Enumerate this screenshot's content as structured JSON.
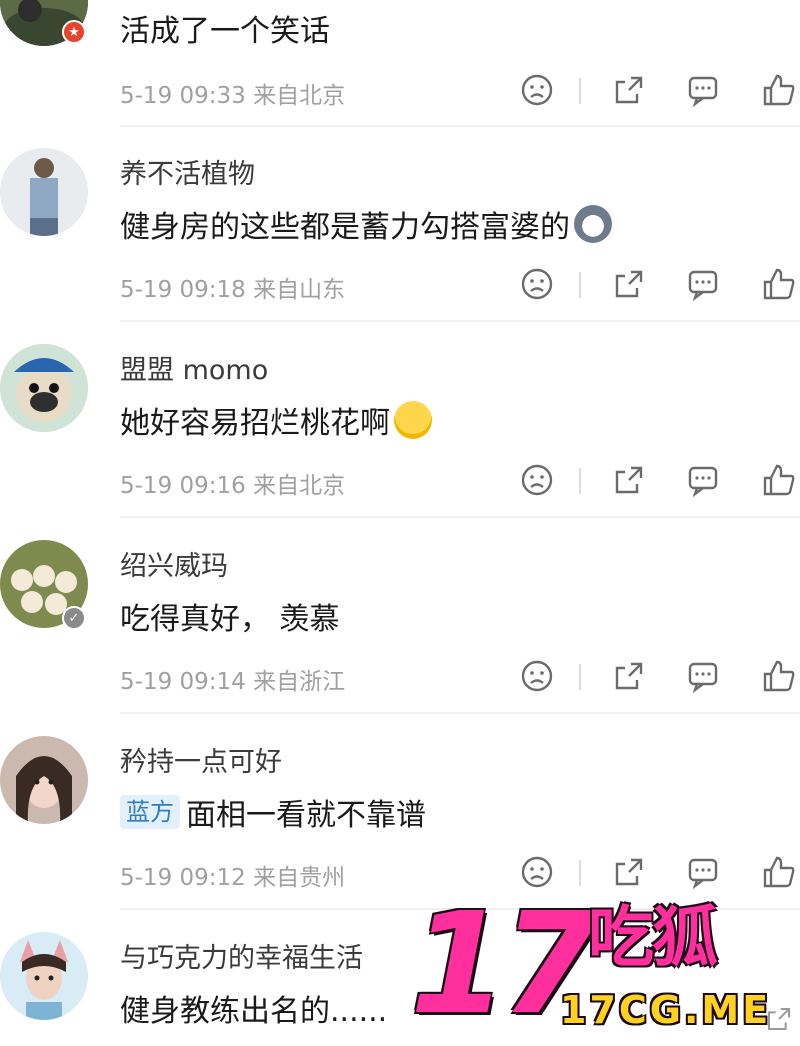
{
  "comments": [
    {
      "username": "",
      "content": "活成了一个笑话",
      "meta": "5-19 09:33 来自北京",
      "badge": "red-star-badge"
    },
    {
      "username": "养不活植物",
      "content": "健身房的这些都是蓄力勾搭富婆的",
      "emoji": "dog-face-emoji",
      "meta": "5-19 09:18 来自山东"
    },
    {
      "username": "盟盟 momo",
      "content": "她好容易招烂桃花啊",
      "emoji": "laugh-cry-emoji",
      "meta": "5-19 09:16 来自北京"
    },
    {
      "username": "绍兴威玛",
      "content": "吃得真好， 羡慕",
      "meta": "5-19 09:14 来自浙江",
      "badge": "verified-badge"
    },
    {
      "username": "矜持一点可好",
      "tag": "蓝方",
      "content": "面相一看就不靠谱",
      "meta": "5-19 09:12 来自贵州"
    },
    {
      "username": "与巧克力的幸福生活",
      "content": "健身教练出名的......",
      "meta": ""
    }
  ],
  "watermark": {
    "number": "17",
    "chinese": "吃狐",
    "site": "17CG.ME"
  },
  "colors": {
    "watermark_pink": "#ff2f9d",
    "watermark_yellow": "#ffd21f",
    "tag_blue": "#2f7fc1",
    "meta_gray": "#a0a0a0"
  }
}
